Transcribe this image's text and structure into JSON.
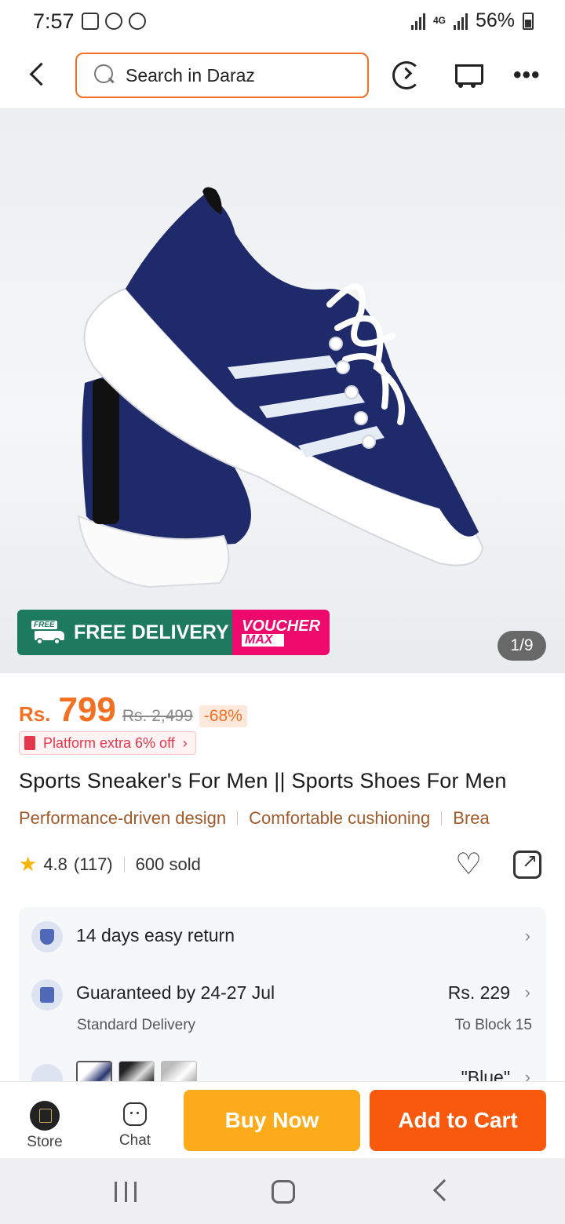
{
  "status": {
    "time": "7:57",
    "network": "4G",
    "battery": "56%"
  },
  "header": {
    "search_placeholder": "Search in Daraz",
    "icons": [
      "back-icon",
      "refresh-icon",
      "cart-icon",
      "more-icon"
    ]
  },
  "gallery": {
    "counter": "1/9",
    "banner_left": "FREE DELIVERY",
    "banner_tag": "FREE",
    "banner_right_top": "VOUCHER",
    "banner_right_bottom": "MAX"
  },
  "product": {
    "currency": "Rs.",
    "price": "799",
    "original_price": "Rs. 2,499",
    "discount": "-68%",
    "promo": "Platform extra 6% off",
    "title": "Sports Sneaker's For Men || Sports Shoes For Men",
    "features": [
      "Performance-driven design",
      "Comfortable cushioning",
      "Brea"
    ],
    "rating": "4.8",
    "review_count": "(117)",
    "sold": "600 sold"
  },
  "info": {
    "returns": "14 days easy return",
    "delivery_title": "Guaranteed by 24-27 Jul",
    "delivery_type": "Standard Delivery",
    "delivery_fee": "Rs. 229",
    "delivery_location": "To Block 15",
    "variant": "\"Blue\""
  },
  "actions": {
    "store_label": "Store",
    "chat_label": "Chat",
    "buy_now": "Buy Now",
    "add_to_cart": "Add to Cart"
  },
  "colors": {
    "accent": "#f36f21",
    "buy_now": "#fcab1b",
    "add_to_cart": "#f8590d",
    "free_delivery": "#1e7a5f",
    "voucher": "#ee0a6c"
  }
}
